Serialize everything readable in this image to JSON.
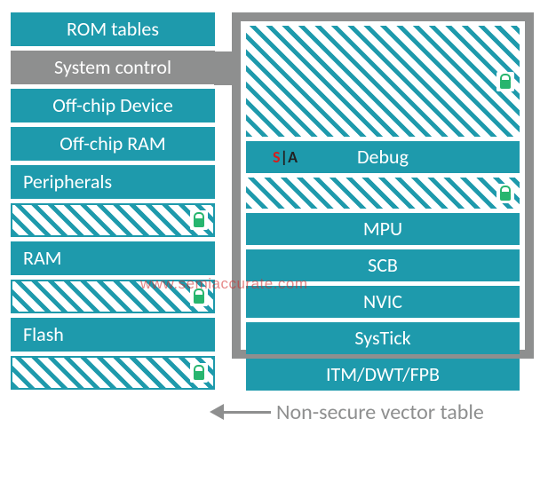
{
  "left": {
    "rom_tables": "ROM tables",
    "system_control": "System control",
    "off_chip_device": "Off-chip Device",
    "off_chip_ram": "Off-chip RAM",
    "peripherals": "Peripherals",
    "ram": "RAM",
    "flash": "Flash"
  },
  "right": {
    "debug": "Debug",
    "mpu": "MPU",
    "scb": "SCB",
    "nvic": "NVIC",
    "systick": "SysTick",
    "itm_dwt_fpb": "ITM/DWT/FPB"
  },
  "arrow_label": "Non-secure vector table",
  "watermark": "www.semiaccurate.com",
  "badge": {
    "s": "S",
    "sep": "|",
    "a": "A"
  },
  "icons": {
    "lock": "lock-icon"
  }
}
